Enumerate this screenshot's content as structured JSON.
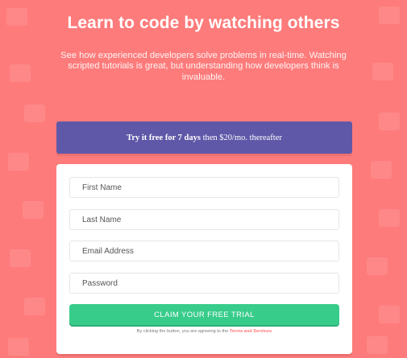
{
  "hero": {
    "headline": "Learn to code by watching others",
    "subtext": "See how experienced developers solve problems in real-time. Watching scripted tutorials is great, but understanding how developers think is invaluable."
  },
  "offer": {
    "prefix": "Try it free for 7 days",
    "suffix": "then $20/mo. thereafter"
  },
  "form": {
    "first_name_placeholder": "First Name",
    "last_name_placeholder": "Last Name",
    "email_placeholder": "Email Address",
    "password_placeholder": "Password",
    "submit_label": "CLAIM YOUR FREE TRIAL",
    "terms_prefix": "By clicking the button, you are agreeing to the",
    "terms_link": "Terms and Services"
  },
  "colors": {
    "background": "#fe7b7b",
    "banner": "#5f58a8",
    "button": "#38cc8b",
    "link": "#ff7a7a"
  }
}
